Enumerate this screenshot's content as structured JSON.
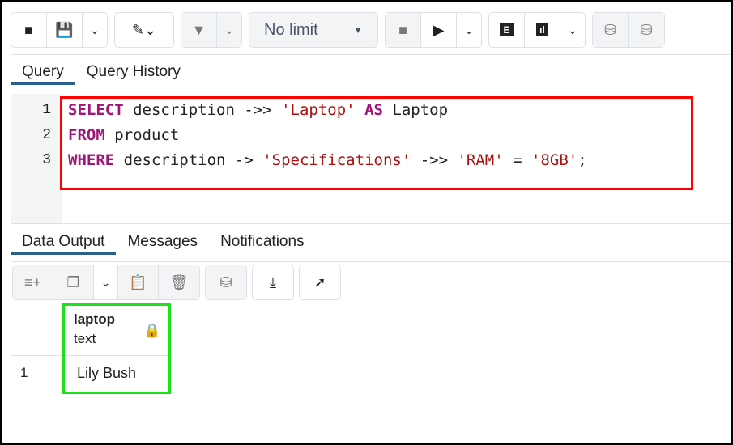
{
  "toolbar": {
    "limit_select": "No limit"
  },
  "query_tabs": [
    "Query",
    "Query History"
  ],
  "editor": {
    "lines": [
      [
        {
          "t": "SELECT",
          "c": "kw"
        },
        {
          "t": " description ->> "
        },
        {
          "t": "'Laptop'",
          "c": "str"
        },
        {
          "t": " "
        },
        {
          "t": "AS",
          "c": "kw"
        },
        {
          "t": " Laptop"
        }
      ],
      [
        {
          "t": "FROM",
          "c": "kw"
        },
        {
          "t": " product"
        }
      ],
      [
        {
          "t": "WHERE",
          "c": "kw"
        },
        {
          "t": " description -> "
        },
        {
          "t": "'Specifications'",
          "c": "str"
        },
        {
          "t": " ->> "
        },
        {
          "t": "'RAM'",
          "c": "str"
        },
        {
          "t": " = "
        },
        {
          "t": "'8GB'",
          "c": "str"
        },
        {
          "t": ";"
        }
      ]
    ],
    "line_numbers": [
      "1",
      "2",
      "3"
    ]
  },
  "output_tabs": [
    "Data Output",
    "Messages",
    "Notifications"
  ],
  "grid": {
    "column": {
      "name": "laptop",
      "type": "text"
    },
    "rows": [
      {
        "num": "1",
        "value": "Lily Bush"
      }
    ]
  },
  "colors": {
    "highlight_query": "#ff0000",
    "highlight_result": "#1de11d",
    "tab_active": "#2b5d8e"
  }
}
